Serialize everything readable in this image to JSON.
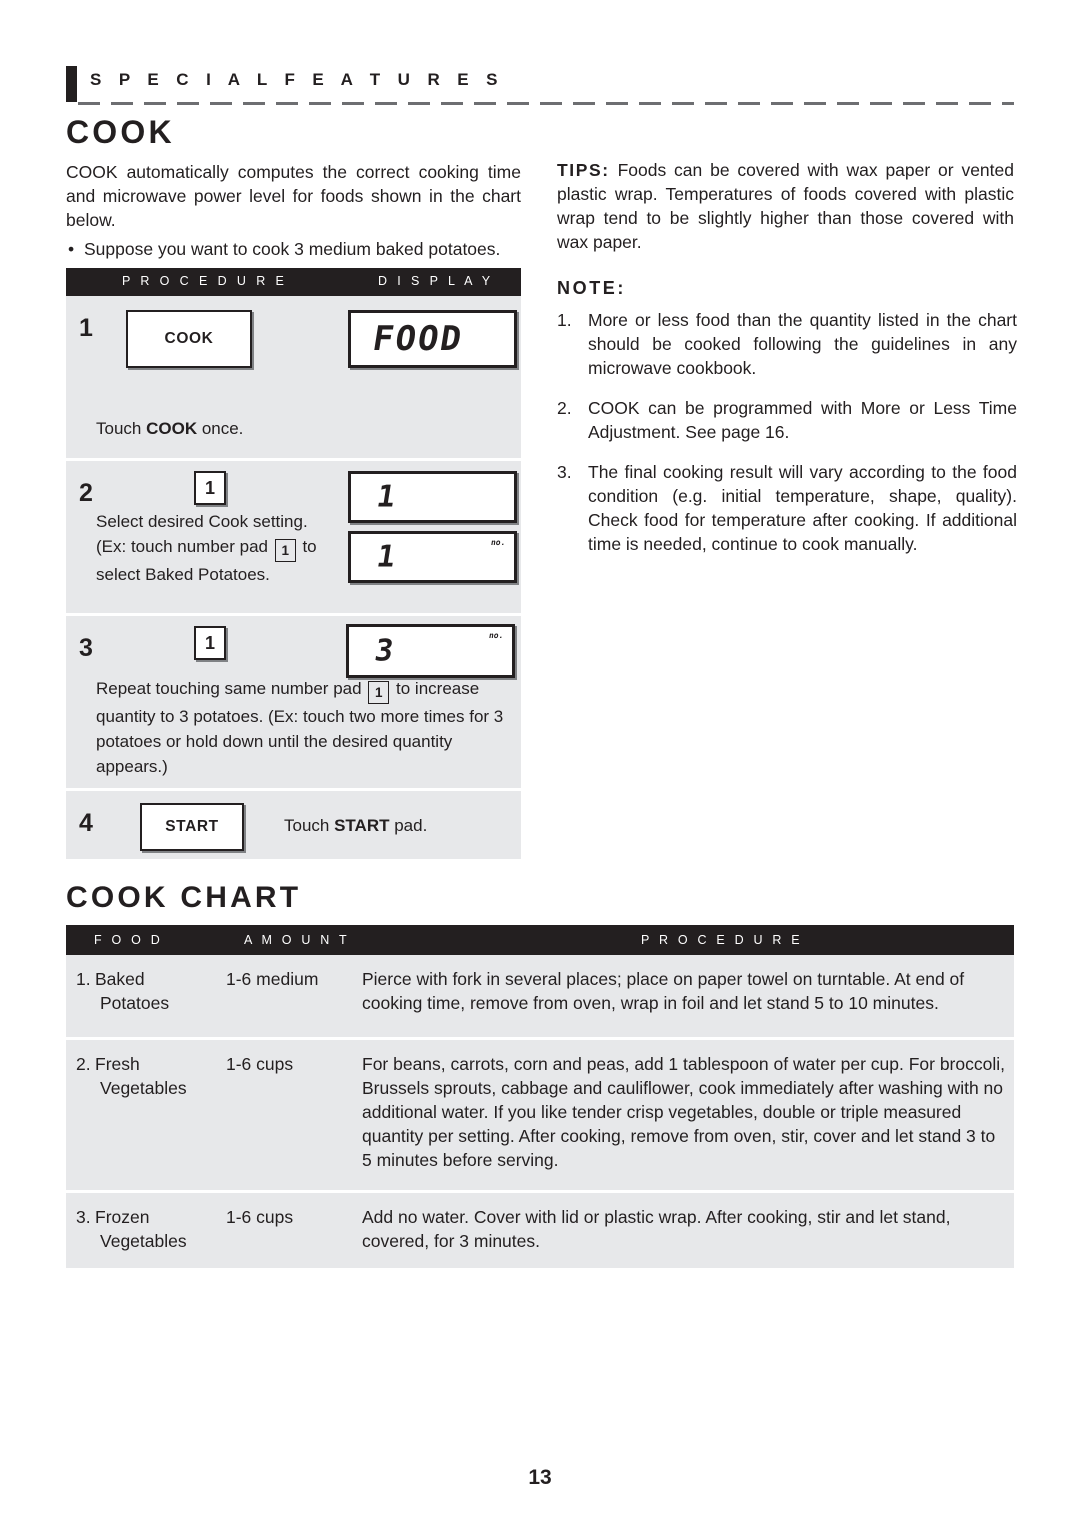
{
  "header": {
    "section_label": "S P E C I A L   F E A T U R E S"
  },
  "cook_section": {
    "title": "COOK",
    "intro": "COOK automatically computes the correct cooking time and microwave power level for foods shown in the chart below.",
    "bullet": "Suppose you want to cook 3 medium baked potatoes."
  },
  "procedure_table": {
    "columns": {
      "procedure": "P R O C E D U R E",
      "display": "D I S P L A Y"
    },
    "steps": [
      {
        "number": "1",
        "pad_label": "COOK",
        "text_pre": "Touch ",
        "text_bold": "COOK",
        "text_post": " once.",
        "display_value": "FOOD",
        "display_indicator": ""
      },
      {
        "number": "2",
        "pad_label": "1",
        "line1": "Select desired Cook setting.",
        "line2_pre": "(Ex: touch number pad ",
        "line2_pad": "1",
        "line2_post": " to",
        "line3": "select Baked Potatoes.",
        "display_value_top": "1",
        "display_value_bottom": "1",
        "display_indicator": "no."
      },
      {
        "number": "3",
        "pad_label": "1",
        "text_pre": "Repeat touching same number pad ",
        "text_pad": "1",
        "text_post": " to increase quantity to 3 potatoes. (Ex: touch two more times for 3 potatoes or hold down until the desired quantity appears.)",
        "display_value": "3",
        "display_indicator": "no."
      },
      {
        "number": "4",
        "pad_label": "START",
        "text_pre": "Touch ",
        "text_bold": "START",
        "text_post": " pad."
      }
    ]
  },
  "tips": {
    "label": "TIPS:",
    "body": " Foods can be covered with wax paper or vented plastic wrap. Temperatures of foods covered with plastic wrap tend to be slightly higher than those covered with wax paper."
  },
  "note": {
    "label": "NOTE:",
    "items": [
      {
        "num": "1.",
        "text": "More or less food than the quantity listed in the chart should be cooked following the guidelines in any microwave cookbook."
      },
      {
        "num": "2.",
        "text": "COOK can be programmed with More or Less Time Adjustment. See page 16."
      },
      {
        "num": "3.",
        "text": "The final cooking result will vary according to the food condition (e.g. initial temperature, shape, quality). Check food for temperature after cooking. If additional time is needed, continue to cook manually."
      }
    ]
  },
  "cook_chart": {
    "title": "COOK CHART",
    "columns": {
      "food": "F O O D",
      "amount": "A M O U N T",
      "procedure": "P R O C E D U R E"
    },
    "rows": [
      {
        "index": "1.",
        "food_line1": "Baked",
        "food_line2": "Potatoes",
        "amount": "1-6 medium",
        "procedure": "Pierce with fork in several places; place on paper towel on turntable. At end of cooking time, remove from oven, wrap in foil and let stand 5 to 10 minutes."
      },
      {
        "index": "2.",
        "food_line1": "Fresh",
        "food_line2": "Vegetables",
        "amount": "1-6 cups",
        "procedure": "For  beans, carrots, corn and peas, add 1 tablespoon of water per cup. For broccoli, Brussels sprouts, cabbage and cauliflower, cook immediately after washing with no additional water. If you like tender crisp vegetables, double or triple measured quantity per setting. After cooking, remove from oven, stir, cover and let stand 3 to 5 minutes before serving."
      },
      {
        "index": "3.",
        "food_line1": "Frozen",
        "food_line2": "Vegetables",
        "amount": "1-6 cups",
        "procedure": "Add no water. Cover with lid or plastic wrap. After cooking, stir and let stand, covered, for 3 minutes."
      }
    ]
  },
  "footer": {
    "page_number": "13"
  }
}
